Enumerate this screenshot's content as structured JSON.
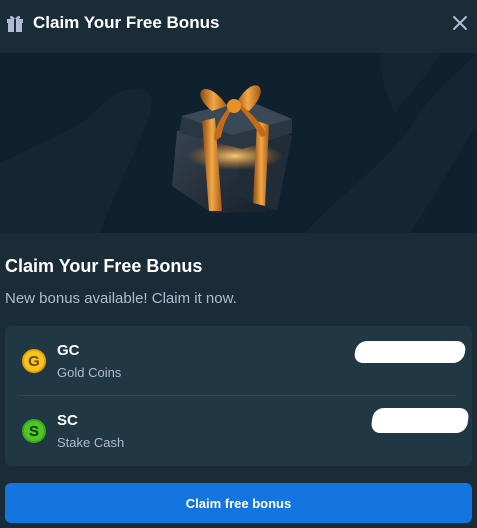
{
  "header": {
    "title": "Claim Your Free Bonus",
    "icon": "gift-icon",
    "close_icon": "close-icon"
  },
  "hero": {
    "image": "gift-box-illustration"
  },
  "content": {
    "title": "Claim Your Free Bonus",
    "subtitle": "New bonus available! Claim it now."
  },
  "currencies": [
    {
      "code": "GC",
      "name": "Gold Coins",
      "coin_letter": "G",
      "color": "#f7c31c"
    },
    {
      "code": "SC",
      "name": "Stake Cash",
      "coin_letter": "S",
      "color": "#4ec426"
    }
  ],
  "button": {
    "label": "Claim free bonus",
    "color": "#1475e1"
  },
  "colors": {
    "background": "#1a2c38",
    "hero_background": "#0f212e",
    "panel": "#213743",
    "muted_text": "#b1bad3"
  }
}
